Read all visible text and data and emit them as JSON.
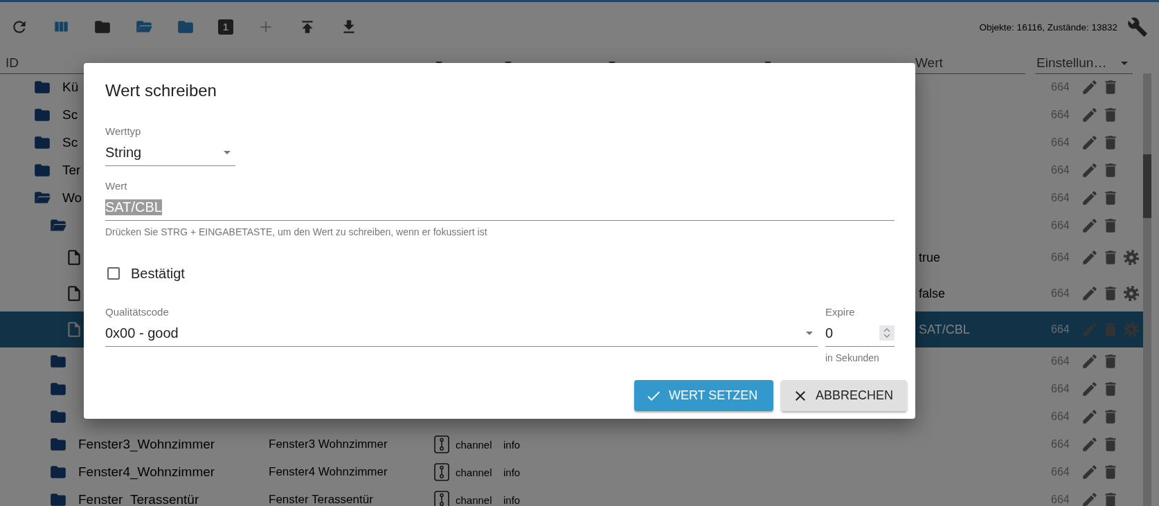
{
  "toolbar": {
    "buttons": [
      {
        "kind": "refresh",
        "disabled": false
      },
      {
        "kind": "columns",
        "disabled": false
      },
      {
        "kind": "folder",
        "disabled": false
      },
      {
        "kind": "folder-open",
        "disabled": false
      },
      {
        "kind": "folder-blue",
        "disabled": false
      },
      {
        "kind": "number",
        "label": "1",
        "disabled": false
      },
      {
        "kind": "add",
        "disabled": true
      },
      {
        "kind": "upload",
        "disabled": false
      },
      {
        "kind": "download",
        "disabled": false
      }
    ],
    "counts": "Objekte: 16116, Zustände: 13832"
  },
  "table": {
    "columns": [
      {
        "label": "ID",
        "dropdown": false
      },
      {
        "dropdown": true
      },
      {
        "dropdown": true
      },
      {
        "dropdown": true
      },
      {
        "dropdown": true
      },
      {
        "label": "Wert",
        "dropdown": false
      },
      {
        "label": "Einstellun…",
        "dropdown": true
      }
    ],
    "rows": [
      {
        "id": "Kü",
        "kind": "folder",
        "expanded": false,
        "selected": false,
        "acl": "664",
        "settings": false
      },
      {
        "id": "Sc",
        "kind": "folder",
        "expanded": false,
        "selected": false,
        "acl": "664",
        "settings": false
      },
      {
        "id": "Sc",
        "kind": "folder",
        "expanded": false,
        "selected": false,
        "acl": "664",
        "settings": false
      },
      {
        "id": "Ter",
        "kind": "folder",
        "expanded": false,
        "selected": false,
        "acl": "664",
        "settings": false
      },
      {
        "id": "Wo",
        "kind": "folder",
        "expanded": true,
        "selected": false,
        "acl": "664",
        "settings": false,
        "children": [
          {
            "kind": "folder",
            "expanded": true,
            "selected": false,
            "acl": "664",
            "settings": false,
            "children": [
              {
                "kind": "state",
                "selected": false,
                "value": "true",
                "acl": "664",
                "settings": true
              },
              {
                "kind": "state",
                "selected": false,
                "value": "false",
                "acl": "664",
                "settings": true
              },
              {
                "kind": "state",
                "selected": true,
                "value": "SAT/CBL",
                "acl": "664",
                "settings": true
              }
            ]
          },
          {
            "kind": "folder",
            "expanded": false,
            "selected": false,
            "acl": "664",
            "settings": false
          },
          {
            "kind": "folder",
            "expanded": false,
            "selected": false,
            "acl": "664",
            "settings": false
          },
          {
            "kind": "folder",
            "expanded": false,
            "selected": false,
            "acl": "664",
            "settings": false
          },
          {
            "id": "Fenster3_Wohnzimmer",
            "name": "Fenster3 Wohnzimmer",
            "type": "channel",
            "role": "info",
            "kind": "folder",
            "expanded": false,
            "selected": false,
            "acl": "664",
            "settings": false
          },
          {
            "id": "Fenster4_Wohnzimmer",
            "name": "Fenster4 Wohnzimmer",
            "type": "channel",
            "role": "info",
            "kind": "folder",
            "expanded": false,
            "selected": false,
            "acl": "664",
            "settings": false
          },
          {
            "id": "Fenster_Terassentür",
            "name": "Fenster Terassentür",
            "type": "channel",
            "role": "info",
            "kind": "folder",
            "expanded": false,
            "selected": false,
            "acl": "664",
            "settings": false
          }
        ]
      }
    ]
  },
  "dialog": {
    "title": "Wert schreiben",
    "value_type": {
      "label": "Werttyp",
      "value": "String"
    },
    "value": {
      "label": "Wert",
      "value": "SAT/CBL",
      "helper": "Drücken Sie STRG + EINGABETASTE, um den Wert zu schreiben, wenn er fokussiert ist"
    },
    "acknowledged": {
      "label": "Bestätigt",
      "checked": false
    },
    "quality": {
      "label": "Qualitätscode",
      "value": "0x00 - good"
    },
    "expire": {
      "label": "Expire",
      "value": "0",
      "helper": "in Sekunden"
    },
    "buttons": [
      {
        "label": "WERT SETZEN",
        "kind": "primary"
      },
      {
        "label": "ABBRECHEN",
        "kind": "cancel"
      }
    ]
  }
}
